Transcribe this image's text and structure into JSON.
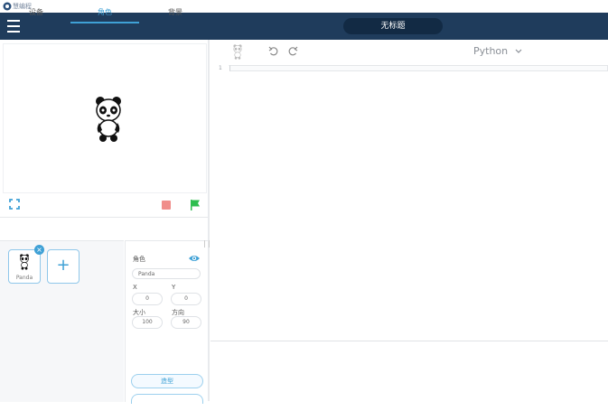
{
  "app": {
    "name": "慧编程",
    "menu_icon": "hamburger-icon"
  },
  "header": {
    "title": "无标题"
  },
  "stage": {
    "sprite_image": "panda",
    "controls": {
      "fullscreen_icon": "fullscreen-icon",
      "stop_icon": "stop-icon",
      "go_icon": "green-flag-icon"
    }
  },
  "tabs": [
    {
      "label": "设备"
    },
    {
      "label": "角色",
      "active": true
    },
    {
      "label": "背景"
    }
  ],
  "sprites": [
    {
      "name": "Panda",
      "selected": true
    }
  ],
  "add_sprite_label": "+",
  "properties": {
    "sprite_label": "角色",
    "name_value": "Panda",
    "x_label": "X",
    "y_label": "Y",
    "x_value": "0",
    "y_value": "0",
    "size_label": "大小",
    "direction_label": "方向",
    "size_value": "100",
    "direction_value": "90",
    "model_button": "造型"
  },
  "editor": {
    "language": "Python",
    "lines": [
      "1"
    ]
  },
  "colors": {
    "header_bg": "#1f3c5c",
    "accent": "#3fa1d6",
    "stop": "#f08d8a",
    "go": "#2dbe4e"
  }
}
